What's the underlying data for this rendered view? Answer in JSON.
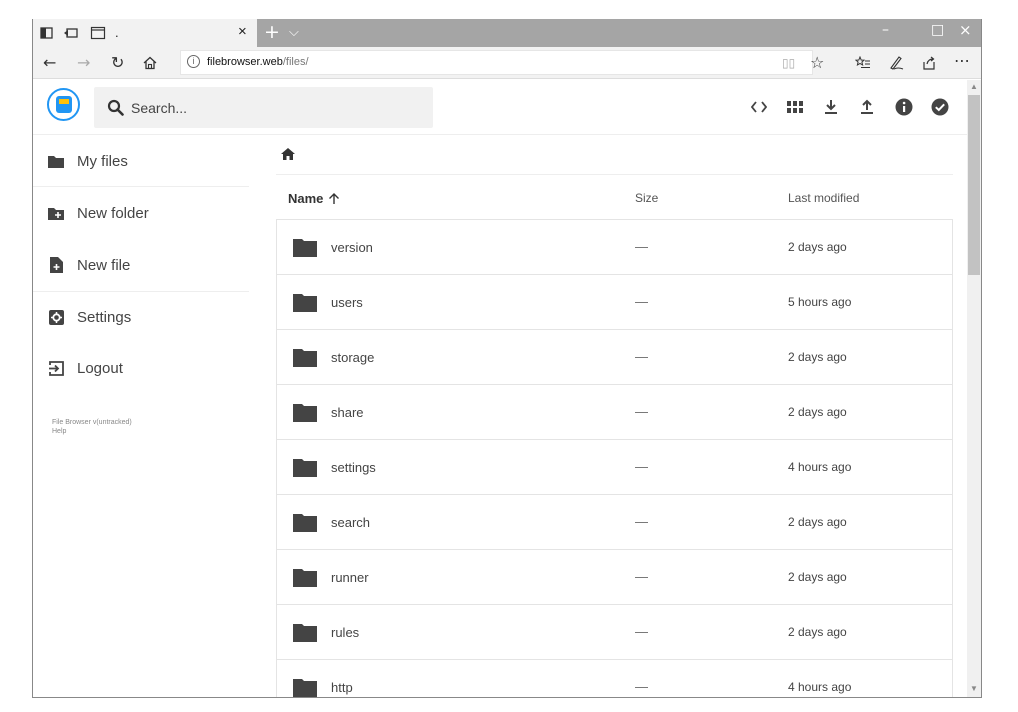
{
  "browser": {
    "tab_title": ".",
    "url_domain": "filebrowser.web",
    "url_path": "/files/",
    "tab_close": "×",
    "new_tab": "+",
    "tab_menu": "⌵",
    "win_min": "–",
    "win_max": "□",
    "win_close": "×"
  },
  "app": {
    "search_placeholder": "Search..."
  },
  "sidebar": {
    "items": [
      {
        "label": "My files",
        "icon": "folder-icon"
      },
      {
        "label": "New folder",
        "icon": "new-folder-icon"
      },
      {
        "label": "New file",
        "icon": "new-file-icon"
      },
      {
        "label": "Settings",
        "icon": "settings-icon"
      },
      {
        "label": "Logout",
        "icon": "logout-icon"
      }
    ],
    "footer_version": "File Browser v(untracked)",
    "footer_help": "Help"
  },
  "table": {
    "headers": {
      "name": "Name",
      "size": "Size",
      "modified": "Last modified"
    },
    "rows": [
      {
        "name": "version",
        "size": "—",
        "modified": "2 days ago"
      },
      {
        "name": "users",
        "size": "—",
        "modified": "5 hours ago"
      },
      {
        "name": "storage",
        "size": "—",
        "modified": "2 days ago"
      },
      {
        "name": "share",
        "size": "—",
        "modified": "2 days ago"
      },
      {
        "name": "settings",
        "size": "—",
        "modified": "4 hours ago"
      },
      {
        "name": "search",
        "size": "—",
        "modified": "2 days ago"
      },
      {
        "name": "runner",
        "size": "—",
        "modified": "2 days ago"
      },
      {
        "name": "rules",
        "size": "—",
        "modified": "2 days ago"
      },
      {
        "name": "http",
        "size": "—",
        "modified": "4 hours ago"
      }
    ]
  },
  "colors": {
    "accent": "#2196f3",
    "titlebar": "#a5a5a5",
    "folder": "#444444"
  }
}
